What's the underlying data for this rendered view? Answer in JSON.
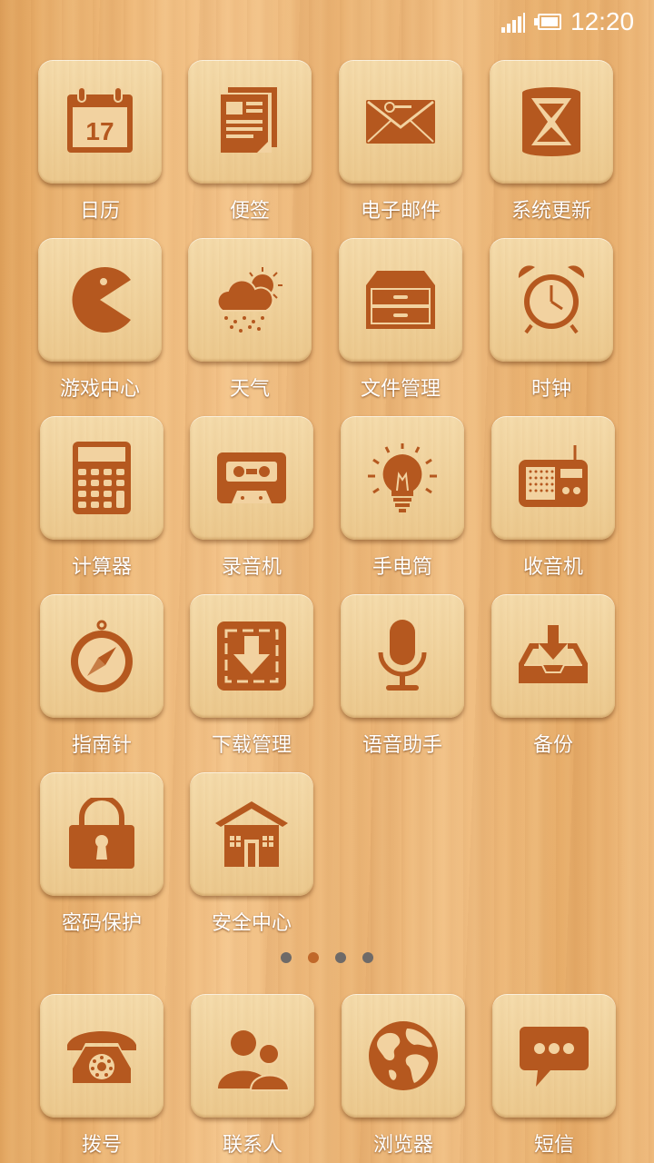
{
  "status_bar": {
    "time": "12:20"
  },
  "apps": [
    {
      "id": "calendar",
      "label": "日历",
      "icon": "calendar-icon",
      "day": "17"
    },
    {
      "id": "notes",
      "label": "便签",
      "icon": "notes-icon"
    },
    {
      "id": "email",
      "label": "电子邮件",
      "icon": "email-icon"
    },
    {
      "id": "system-update",
      "label": "系统更新",
      "icon": "hourglass-icon"
    },
    {
      "id": "game-center",
      "label": "游戏中心",
      "icon": "pacman-icon"
    },
    {
      "id": "weather",
      "label": "天气",
      "icon": "weather-icon"
    },
    {
      "id": "file-manager",
      "label": "文件管理",
      "icon": "drawer-icon"
    },
    {
      "id": "clock",
      "label": "时钟",
      "icon": "alarm-clock-icon"
    },
    {
      "id": "calculator",
      "label": "计算器",
      "icon": "calculator-icon"
    },
    {
      "id": "recorder",
      "label": "录音机",
      "icon": "cassette-icon"
    },
    {
      "id": "flashlight",
      "label": "手电筒",
      "icon": "lightbulb-icon"
    },
    {
      "id": "radio",
      "label": "收音机",
      "icon": "radio-icon"
    },
    {
      "id": "compass",
      "label": "指南针",
      "icon": "compass-icon"
    },
    {
      "id": "download-manager",
      "label": "下载管理",
      "icon": "download-icon"
    },
    {
      "id": "voice-assistant",
      "label": "语音助手",
      "icon": "microphone-icon"
    },
    {
      "id": "backup",
      "label": "备份",
      "icon": "inbox-icon"
    },
    {
      "id": "password-protect",
      "label": "密码保护",
      "icon": "padlock-icon"
    },
    {
      "id": "security-center",
      "label": "安全中心",
      "icon": "house-icon"
    }
  ],
  "page_indicator": {
    "count": 4,
    "active": 2,
    "active_color": "#c0682a",
    "inactive_color": "#6e6a68"
  },
  "dock": [
    {
      "id": "dialer",
      "label": "拨号",
      "icon": "telephone-icon"
    },
    {
      "id": "contacts",
      "label": "联系人",
      "icon": "contacts-icon"
    },
    {
      "id": "browser",
      "label": "浏览器",
      "icon": "globe-icon"
    },
    {
      "id": "messages",
      "label": "短信",
      "icon": "message-bubble-icon"
    }
  ],
  "colors": {
    "icon_fill": "#b5581f",
    "label_text": "#ffffff"
  }
}
